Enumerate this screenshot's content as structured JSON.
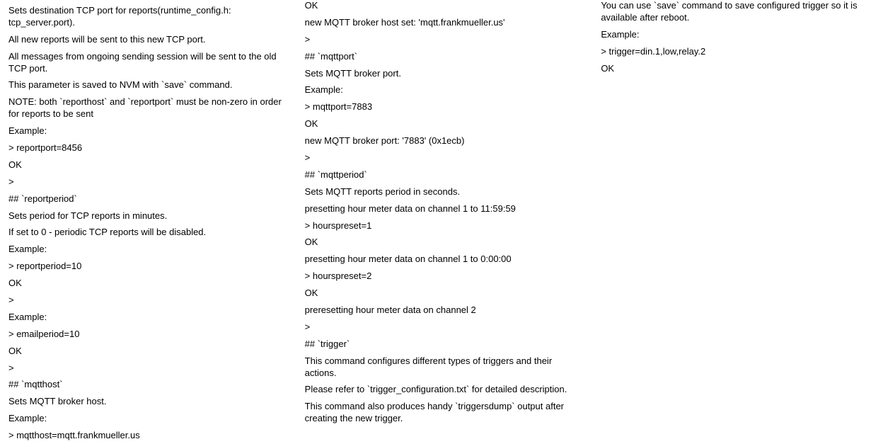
{
  "col1": {
    "p1": "Sets destination TCP port for reports(runtime_config.h: tcp_server.port).",
    "p2": "All new reports will be sent to this new TCP port.",
    "p3": "All messages from ongoing sending session will be sent to the old TCP port.",
    "p4": "This parameter is saved to NVM with `save` command.",
    "p5": "NOTE: both `reporthost` and `reportport` must be non-zero in order for reports to be sent",
    "p6": "Example:",
    "p7": "> reportport=8456",
    "p8": "OK",
    "p9": ">",
    "h1": "## `reportperiod`",
    "p10": "Sets period for TCP reports in minutes.",
    "p11": "If set to 0 - periodic TCP reports will be disabled.",
    "p12": "Example:",
    "p13": "> reportperiod=10",
    "p14": "OK",
    "p15": ">"
  },
  "col2": {
    "p1": "Example:",
    "p2": "> emailperiod=10",
    "p3": "OK",
    "p4": ">",
    "h1": "## `mqtthost`",
    "p5": "Sets MQTT broker host.",
    "p6": "Example:",
    "p7": "> mqtthost=mqtt.frankmueller.us",
    "p8": "OK",
    "p9": "new MQTT broker host set: 'mqtt.frankmueller.us'",
    "p10": ">",
    "h2": "## `mqttport`",
    "p11": "Sets MQTT broker port.",
    "p12": "Example:",
    "p13": "> mqttport=7883",
    "p14": "OK",
    "p15": "new MQTT broker port: '7883' (0x1ecb)",
    "p16": ">",
    "h3": "## `mqttperiod`",
    "p17": "Sets MQTT reports period in seconds."
  },
  "col3": {
    "p1": "presetting hour meter data on channel 1 to 11:59:59",
    "p2": "> hourspreset=1",
    "p3": "OK",
    "p4": "presetting hour meter data on channel 1 to 0:00:00",
    "p5": "> hourspreset=2",
    "p6": "OK",
    "p7": "preresetting hour meter data on channel 2",
    "p8": ">",
    "h1": "## `trigger`",
    "p9": "This command configures different types of triggers and their actions.",
    "p10": "Please refer to `trigger_configuration.txt` for detailed description.",
    "p11": "This command also produces handy `triggersdump` output after creating the new trigger.",
    "p12": "You can use `save` command to save configured trigger so it is available after reboot.",
    "p13": "Example:",
    "p14": "> trigger=din.1,low,relay.2",
    "p15": "OK"
  }
}
